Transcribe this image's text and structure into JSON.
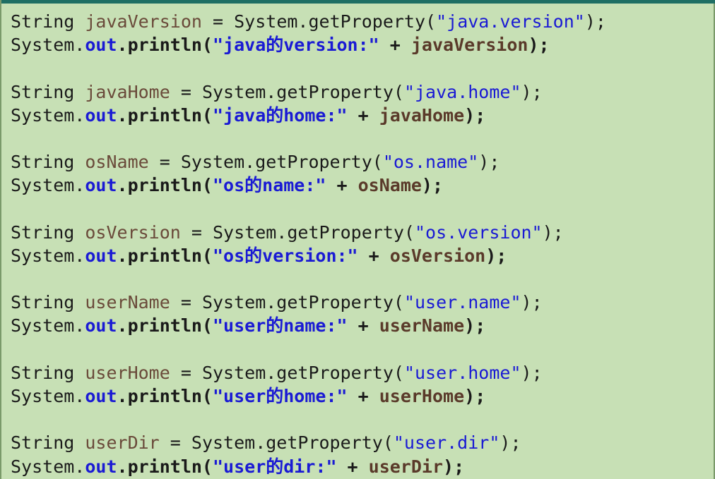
{
  "blocks": [
    {
      "decl_type": "String",
      "var_name": "javaVersion",
      "assign_op": " = ",
      "call_prefix": "System.getProperty(",
      "prop_key": "\"java.version\"",
      "call_suffix": ");",
      "print_prefix": "System.",
      "print_field": "out",
      "print_method": ".println(",
      "print_label": "\"java的version:\"",
      "concat_op": " + ",
      "print_var": "javaVersion",
      "print_suffix": ");"
    },
    {
      "decl_type": "String",
      "var_name": "javaHome",
      "assign_op": " = ",
      "call_prefix": "System.getProperty(",
      "prop_key": "\"java.home\"",
      "call_suffix": ");",
      "print_prefix": "System.",
      "print_field": "out",
      "print_method": ".println(",
      "print_label": "\"java的home:\"",
      "concat_op": " + ",
      "print_var": "javaHome",
      "print_suffix": ");"
    },
    {
      "decl_type": "String",
      "var_name": "osName",
      "assign_op": " = ",
      "call_prefix": "System.getProperty(",
      "prop_key": "\"os.name\"",
      "call_suffix": ");",
      "print_prefix": "System.",
      "print_field": "out",
      "print_method": ".println(",
      "print_label": "\"os的name:\"",
      "concat_op": " + ",
      "print_var": "osName",
      "print_suffix": ");"
    },
    {
      "decl_type": "String",
      "var_name": "osVersion",
      "assign_op": " = ",
      "call_prefix": "System.getProperty(",
      "prop_key": "\"os.version\"",
      "call_suffix": ");",
      "print_prefix": "System.",
      "print_field": "out",
      "print_method": ".println(",
      "print_label": "\"os的version:\"",
      "concat_op": " + ",
      "print_var": "osVersion",
      "print_suffix": ");"
    },
    {
      "decl_type": "String",
      "var_name": "userName",
      "assign_op": " = ",
      "call_prefix": "System.getProperty(",
      "prop_key": "\"user.name\"",
      "call_suffix": ");",
      "print_prefix": "System.",
      "print_field": "out",
      "print_method": ".println(",
      "print_label": "\"user的name:\"",
      "concat_op": " + ",
      "print_var": "userName",
      "print_suffix": ");"
    },
    {
      "decl_type": "String",
      "var_name": "userHome",
      "assign_op": " = ",
      "call_prefix": "System.getProperty(",
      "prop_key": "\"user.home\"",
      "call_suffix": ");",
      "print_prefix": "System.",
      "print_field": "out",
      "print_method": ".println(",
      "print_label": "\"user的home:\"",
      "concat_op": " + ",
      "print_var": "userHome",
      "print_suffix": ");"
    },
    {
      "decl_type": "String",
      "var_name": "userDir",
      "assign_op": " = ",
      "call_prefix": "System.getProperty(",
      "prop_key": "\"user.dir\"",
      "call_suffix": ");",
      "print_prefix": "System.",
      "print_field": "out",
      "print_method": ".println(",
      "print_label": "\"user的dir:\"",
      "concat_op": " + ",
      "print_var": "userDir",
      "print_suffix": ");"
    }
  ],
  "colors": {
    "background": "#c7e0b5",
    "top_bar": "#1f6f64",
    "string_literal": "#1a1ad4",
    "variable": "#6a4a3a",
    "plain_text": "#1a1a1a"
  }
}
